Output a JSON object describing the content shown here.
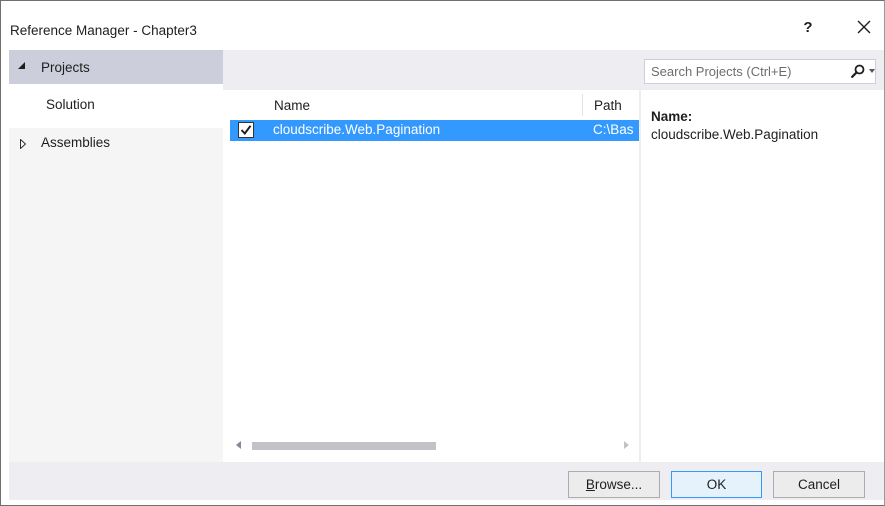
{
  "window": {
    "title": "Reference Manager - Chapter3",
    "help_label": "?"
  },
  "nav": {
    "projects_label": "Projects",
    "solution_label": "Solution",
    "assemblies_label": "Assemblies"
  },
  "search": {
    "placeholder": "Search Projects (Ctrl+E)"
  },
  "list": {
    "columns": [
      "Name",
      "Path"
    ],
    "rows": [
      {
        "checked": true,
        "name": "cloudscribe.Web.Pagination",
        "path": "C:\\Bas"
      }
    ]
  },
  "details": {
    "label": "Name:",
    "value": "cloudscribe.Web.Pagination"
  },
  "buttons": {
    "browse_accel": "B",
    "browse_rest": "rowse...",
    "ok": "OK",
    "cancel": "Cancel"
  },
  "colors": {
    "selection": "#3399ff",
    "nav_selected": "#cccedb",
    "panel_bg": "#eeeef2"
  }
}
